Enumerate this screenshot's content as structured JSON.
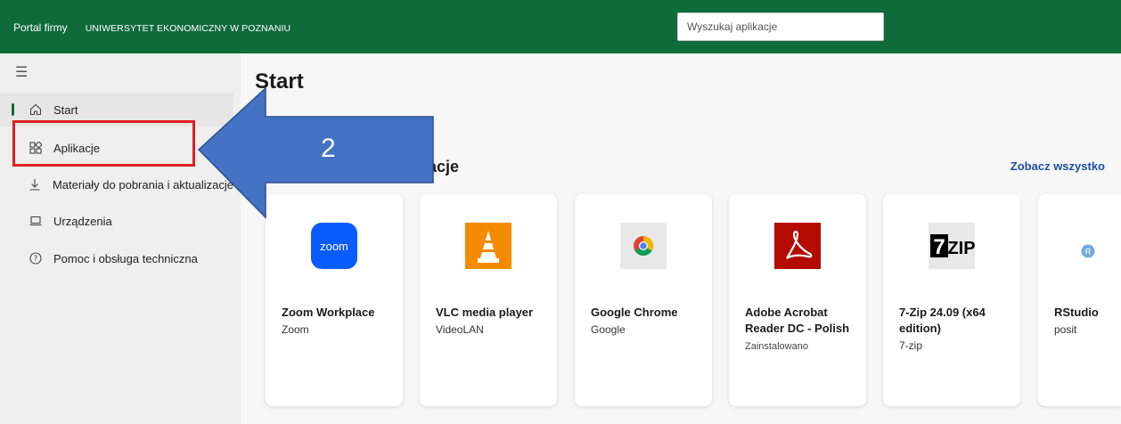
{
  "topbar": {
    "portal_label": "Portal firmy",
    "org_name": "UNIWERSYTET EKONOMICZNY W POZNANIU",
    "search_placeholder": "Wyszukaj aplikacje"
  },
  "sidebar": {
    "items": [
      {
        "label": "Start",
        "icon": "home-icon"
      },
      {
        "label": "Aplikacje",
        "icon": "apps-grid-icon"
      },
      {
        "label": "Materiały do pobrania i aktualizacje",
        "icon": "download-icon"
      },
      {
        "label": "Urządzenia",
        "icon": "laptop-icon"
      },
      {
        "label": "Pomoc i obsługa techniczna",
        "icon": "help-circle-icon"
      }
    ]
  },
  "main": {
    "title": "Start",
    "section_title": "likacje",
    "see_all": "Zobacz wszystko",
    "apps": [
      {
        "name": "Zoom Workplace",
        "publisher": "Zoom",
        "status": "",
        "icon": "zoom-icon"
      },
      {
        "name": "VLC media player",
        "publisher": "VideoLAN",
        "status": "",
        "icon": "vlc-icon"
      },
      {
        "name": "Google Chrome",
        "publisher": "Google",
        "status": "",
        "icon": "chrome-icon"
      },
      {
        "name": "Adobe Acrobat Reader DC - Polish",
        "publisher": "Zainstalowano",
        "status": "",
        "icon": "acrobat-icon"
      },
      {
        "name": "7-Zip 24.09 (x64 edition)",
        "publisher": "7-zip",
        "status": "",
        "icon": "7zip-icon"
      },
      {
        "name": "RStudio",
        "publisher": "posit",
        "status": "",
        "icon": "rstudio-icon"
      }
    ]
  },
  "annotation": {
    "number": "2",
    "box_color": "#e02020",
    "arrow_color": "#4472c4"
  }
}
